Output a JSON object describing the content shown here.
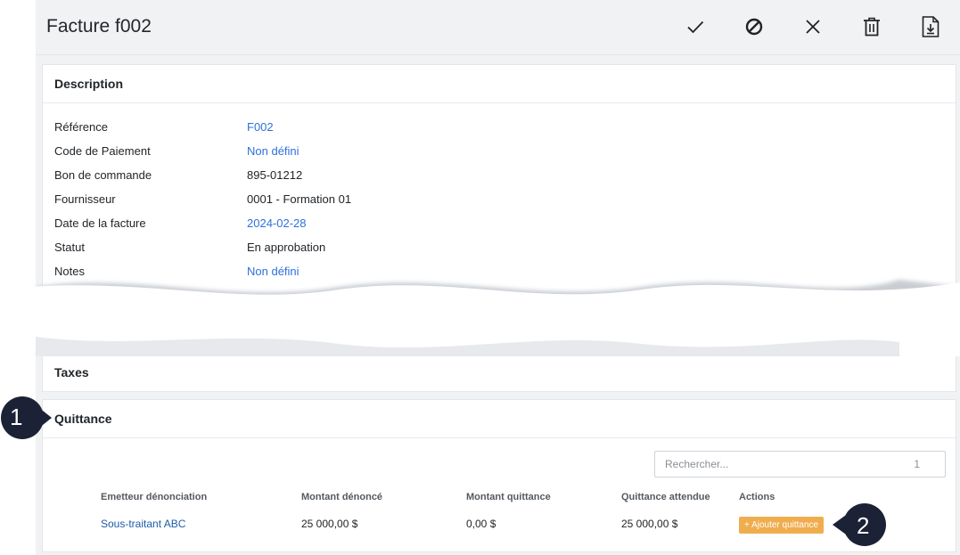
{
  "header": {
    "title": "Facture f002"
  },
  "toolbar": {
    "approve_icon": "check-icon",
    "reject_icon": "block-icon",
    "cancel_icon": "close-icon",
    "delete_icon": "trash-icon",
    "export_icon": "file-download-icon"
  },
  "description": {
    "title": "Description",
    "fields": [
      {
        "label": "Référence",
        "value": "F002"
      },
      {
        "label": "Code de Paiement",
        "value": "Non défini"
      },
      {
        "label": "Bon de commande",
        "value": "895-01212"
      },
      {
        "label": "Fournisseur",
        "value": "0001 - Formation 01"
      },
      {
        "label": "Date de la facture",
        "value": "2024-02-28"
      },
      {
        "label": "Statut",
        "value": "En approbation"
      },
      {
        "label": "Notes",
        "value": "Non défini"
      }
    ]
  },
  "taxes": {
    "title": "Taxes"
  },
  "quittance": {
    "title": "Quittance",
    "search_placeholder": "Rechercher...",
    "search_count": "1",
    "columns": [
      "Emetteur dénonciation",
      "Montant dénoncé",
      "Montant quittance",
      "Quittance attendue",
      "Actions"
    ],
    "rows": [
      {
        "emetteur": "Sous-traitant ABC",
        "montant_denonce": "25 000,00 $",
        "montant_quittance": "0,00 $",
        "quittance_attendue": "25 000,00 $",
        "action_label": "+ Ajouter quittance"
      }
    ]
  },
  "callouts": [
    "1",
    "2"
  ],
  "colors": {
    "link": "#2f6fde",
    "button": "#f0ad4e",
    "callout": "#1b2236"
  }
}
